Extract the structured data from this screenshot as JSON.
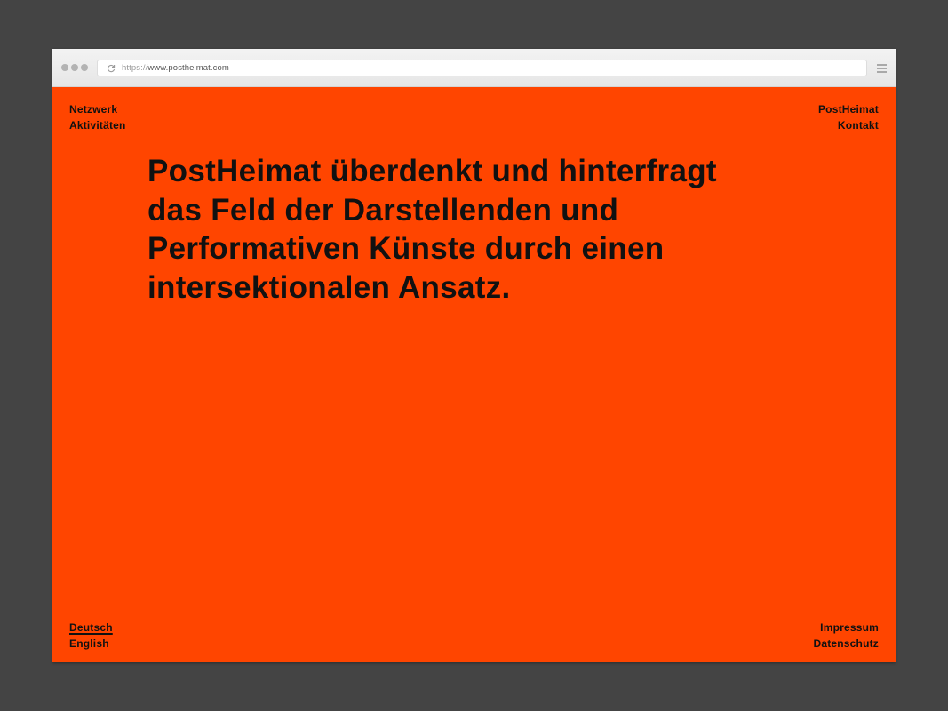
{
  "browser": {
    "url_scheme": "https://",
    "url_host": "www.postheimat.com"
  },
  "nav": {
    "top_left": [
      "Netzwerk",
      "Aktivitäten"
    ],
    "top_right": [
      "PostHeimat",
      "Kontakt"
    ],
    "bottom_left": [
      "Deutsch",
      "English"
    ],
    "bottom_right": [
      "Impressum",
      "Datenschutz"
    ],
    "active_language": "Deutsch"
  },
  "main": {
    "headline": "PostHeimat überdenkt und hinterfragt das Feld der Darstellenden und Performativen Künste durch einen intersektionalen Ansatz."
  },
  "colors": {
    "background": "#ff4500",
    "text": "#111111",
    "surround": "#444444"
  },
  "icons": {
    "window_controls": "traffic-light-dots",
    "reload": "reload-icon",
    "menu": "hamburger-menu-icon"
  }
}
